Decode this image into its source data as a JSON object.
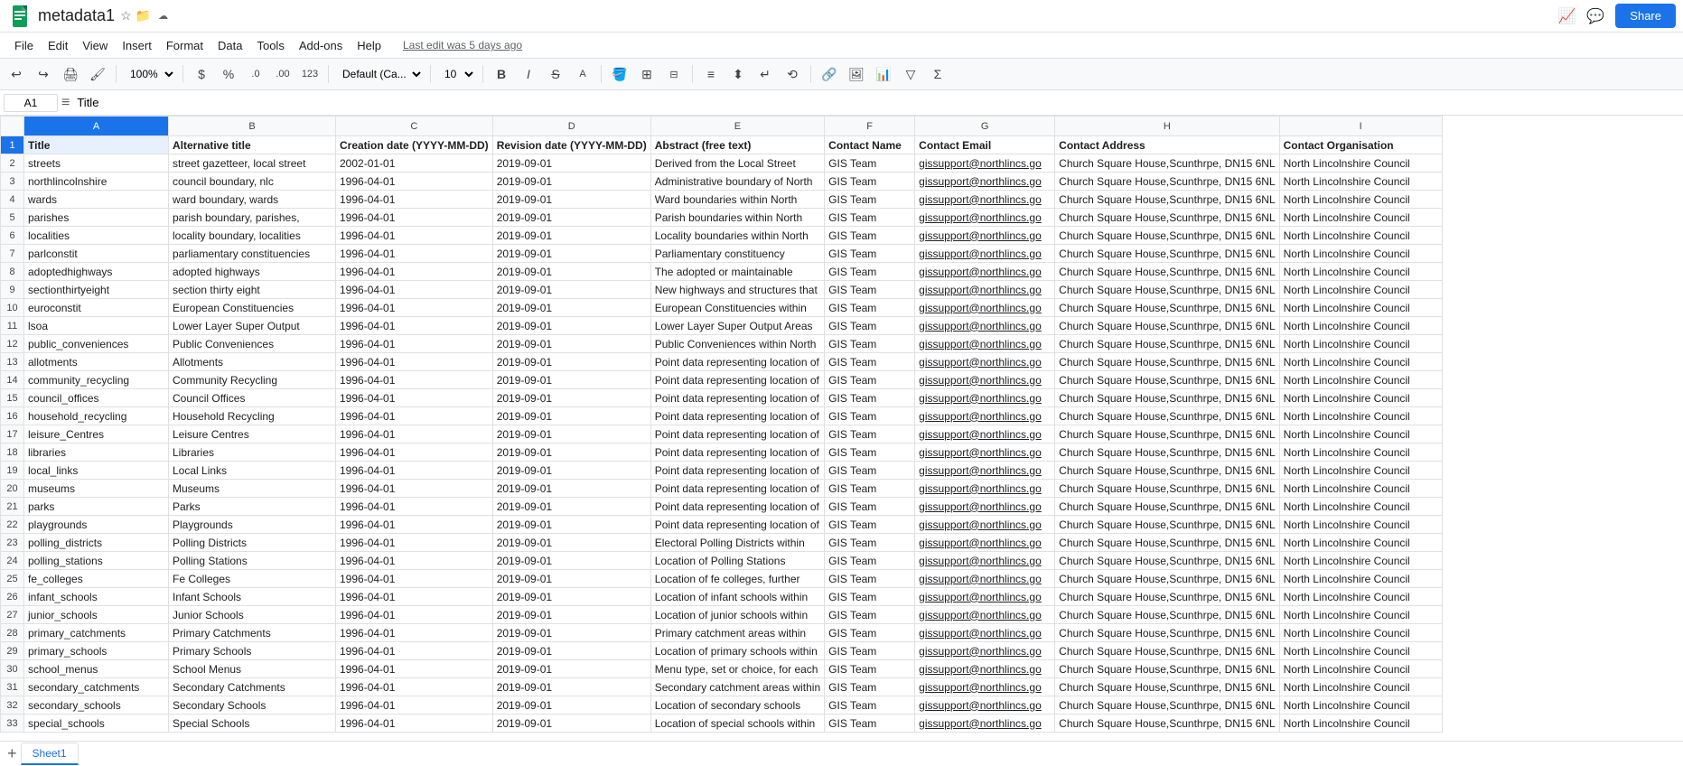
{
  "app": {
    "icon_color": "#0f9d58",
    "title": "metadata1",
    "last_edit": "Last edit was 5 days ago",
    "share_label": "Share"
  },
  "menu": {
    "items": [
      "File",
      "Edit",
      "View",
      "Insert",
      "Format",
      "Data",
      "Tools",
      "Add-ons",
      "Help"
    ]
  },
  "toolbar": {
    "zoom": "100%",
    "format_dollar": "$",
    "format_pct": "%",
    "format_comma": ".0",
    "format_dec": ".00",
    "format_123": "123",
    "font_family": "Default (Ca...",
    "font_size": "10"
  },
  "formula_bar": {
    "cell_name": "A1",
    "formula_value": "Title"
  },
  "columns": [
    {
      "id": "A",
      "label": "A"
    },
    {
      "id": "B",
      "label": "B"
    },
    {
      "id": "C",
      "label": "C"
    },
    {
      "id": "D",
      "label": "D"
    },
    {
      "id": "E",
      "label": "E"
    },
    {
      "id": "F",
      "label": "F"
    },
    {
      "id": "G",
      "label": "G"
    },
    {
      "id": "H",
      "label": "H"
    },
    {
      "id": "I",
      "label": "I"
    }
  ],
  "header_row": {
    "title": "Title",
    "alt_title": "Alternative title",
    "creation_date": "Creation date (YYYY-MM-DD)",
    "revision_date": "Revision date (YYYY-MM-DD)",
    "abstract": "Abstract (free text)",
    "contact_name": "Contact Name",
    "contact_email": "Contact Email",
    "contact_address": "Contact Address",
    "contact_org": "Contact Organisation"
  },
  "rows": [
    {
      "title": "streets",
      "alt": "street gazetteer, local street",
      "created": "2002-01-01",
      "revised": "2019-09-01",
      "abstract": "Derived from the Local Street",
      "contact_name": "GIS Team",
      "contact_email": "gissupport@northlincs.go",
      "contact_address": "Church Square House,Scunthrpe, DN15 6NL",
      "contact_org": "North Lincolnshire Council"
    },
    {
      "title": "northlincolnshire",
      "alt": "council boundary, nlc",
      "created": "1996-04-01",
      "revised": "2019-09-01",
      "abstract": "Administrative boundary of North",
      "contact_name": "GIS Team",
      "contact_email": "gissupport@northlincs.go",
      "contact_address": "Church Square House,Scunthrpe, DN15 6NL",
      "contact_org": "North Lincolnshire Council"
    },
    {
      "title": "wards",
      "alt": "ward boundary, wards",
      "created": "1996-04-01",
      "revised": "2019-09-01",
      "abstract": "Ward boundaries within North",
      "contact_name": "GIS Team",
      "contact_email": "gissupport@northlincs.go",
      "contact_address": "Church Square House,Scunthrpe, DN15 6NL",
      "contact_org": "North Lincolnshire Council"
    },
    {
      "title": "parishes",
      "alt": "parish boundary, parishes,",
      "created": "1996-04-01",
      "revised": "2019-09-01",
      "abstract": "Parish boundaries within North",
      "contact_name": "GIS Team",
      "contact_email": "gissupport@northlincs.go",
      "contact_address": "Church Square House,Scunthrpe, DN15 6NL",
      "contact_org": "North Lincolnshire Council"
    },
    {
      "title": "localities",
      "alt": "locality boundary, localities",
      "created": "1996-04-01",
      "revised": "2019-09-01",
      "abstract": "Locality boundaries within North",
      "contact_name": "GIS Team",
      "contact_email": "gissupport@northlincs.go",
      "contact_address": "Church Square House,Scunthrpe, DN15 6NL",
      "contact_org": "North Lincolnshire Council"
    },
    {
      "title": "parlconstit",
      "alt": "parliamentary constituencies",
      "created": "1996-04-01",
      "revised": "2019-09-01",
      "abstract": "Parliamentary constituency",
      "contact_name": "GIS Team",
      "contact_email": "gissupport@northlincs.go",
      "contact_address": "Church Square House,Scunthrpe, DN15 6NL",
      "contact_org": "North Lincolnshire Council"
    },
    {
      "title": "adoptedhighways",
      "alt": "adopted highways",
      "created": "1996-04-01",
      "revised": "2019-09-01",
      "abstract": "The adopted or maintainable",
      "contact_name": "GIS Team",
      "contact_email": "gissupport@northlincs.go",
      "contact_address": "Church Square House,Scunthrpe, DN15 6NL",
      "contact_org": "North Lincolnshire Council"
    },
    {
      "title": "sectionthirtyeight",
      "alt": "section thirty eight",
      "created": "1996-04-01",
      "revised": "2019-09-01",
      "abstract": "New highways and structures that",
      "contact_name": "GIS Team",
      "contact_email": "gissupport@northlincs.go",
      "contact_address": "Church Square House,Scunthrpe, DN15 6NL",
      "contact_org": "North Lincolnshire Council"
    },
    {
      "title": "euroconstit",
      "alt": "European Constituencies",
      "created": "1996-04-01",
      "revised": "2019-09-01",
      "abstract": "European Constituencies within",
      "contact_name": "GIS Team",
      "contact_email": "gissupport@northlincs.go",
      "contact_address": "Church Square House,Scunthrpe, DN15 6NL",
      "contact_org": "North Lincolnshire Council"
    },
    {
      "title": "lsoa",
      "alt": "Lower Layer Super Output",
      "created": "1996-04-01",
      "revised": "2019-09-01",
      "abstract": "Lower Layer Super Output Areas",
      "contact_name": "GIS Team",
      "contact_email": "gissupport@northlincs.go",
      "contact_address": "Church Square House,Scunthrpe, DN15 6NL",
      "contact_org": "North Lincolnshire Council"
    },
    {
      "title": "public_conveniences",
      "alt": "Public Conveniences",
      "created": "1996-04-01",
      "revised": "2019-09-01",
      "abstract": "Public Conveniences within North",
      "contact_name": "GIS Team",
      "contact_email": "gissupport@northlincs.go",
      "contact_address": "Church Square House,Scunthrpe, DN15 6NL",
      "contact_org": "North Lincolnshire Council"
    },
    {
      "title": "allotments",
      "alt": "Allotments",
      "created": "1996-04-01",
      "revised": "2019-09-01",
      "abstract": "Point data representing location of",
      "contact_name": "GIS Team",
      "contact_email": "gissupport@northlincs.go",
      "contact_address": "Church Square House,Scunthrpe, DN15 6NL",
      "contact_org": "North Lincolnshire Council"
    },
    {
      "title": "community_recycling",
      "alt": "Community Recycling",
      "created": "1996-04-01",
      "revised": "2019-09-01",
      "abstract": "Point data representing location of",
      "contact_name": "GIS Team",
      "contact_email": "gissupport@northlincs.go",
      "contact_address": "Church Square House,Scunthrpe, DN15 6NL",
      "contact_org": "North Lincolnshire Council"
    },
    {
      "title": "council_offices",
      "alt": "Council Offices",
      "created": "1996-04-01",
      "revised": "2019-09-01",
      "abstract": "Point data representing location of",
      "contact_name": "GIS Team",
      "contact_email": "gissupport@northlincs.go",
      "contact_address": "Church Square House,Scunthrpe, DN15 6NL",
      "contact_org": "North Lincolnshire Council"
    },
    {
      "title": "household_recycling",
      "alt": "Household Recycling",
      "created": "1996-04-01",
      "revised": "2019-09-01",
      "abstract": "Point data representing location of",
      "contact_name": "GIS Team",
      "contact_email": "gissupport@northlincs.go",
      "contact_address": "Church Square House,Scunthrpe, DN15 6NL",
      "contact_org": "North Lincolnshire Council"
    },
    {
      "title": "leisure_Centres",
      "alt": "Leisure Centres",
      "created": "1996-04-01",
      "revised": "2019-09-01",
      "abstract": "Point data representing location of",
      "contact_name": "GIS Team",
      "contact_email": "gissupport@northlincs.go",
      "contact_address": "Church Square House,Scunthrpe, DN15 6NL",
      "contact_org": "North Lincolnshire Council"
    },
    {
      "title": "libraries",
      "alt": "Libraries",
      "created": "1996-04-01",
      "revised": "2019-09-01",
      "abstract": "Point data representing location of",
      "contact_name": "GIS Team",
      "contact_email": "gissupport@northlincs.go",
      "contact_address": "Church Square House,Scunthrpe, DN15 6NL",
      "contact_org": "North Lincolnshire Council"
    },
    {
      "title": "local_links",
      "alt": "Local Links",
      "created": "1996-04-01",
      "revised": "2019-09-01",
      "abstract": "Point data representing location of",
      "contact_name": "GIS Team",
      "contact_email": "gissupport@northlincs.go",
      "contact_address": "Church Square House,Scunthrpe, DN15 6NL",
      "contact_org": "North Lincolnshire Council"
    },
    {
      "title": "museums",
      "alt": "Museums",
      "created": "1996-04-01",
      "revised": "2019-09-01",
      "abstract": "Point data representing location of",
      "contact_name": "GIS Team",
      "contact_email": "gissupport@northlincs.go",
      "contact_address": "Church Square House,Scunthrpe, DN15 6NL",
      "contact_org": "North Lincolnshire Council"
    },
    {
      "title": "parks",
      "alt": "Parks",
      "created": "1996-04-01",
      "revised": "2019-09-01",
      "abstract": "Point data representing location of",
      "contact_name": "GIS Team",
      "contact_email": "gissupport@northlincs.go",
      "contact_address": "Church Square House,Scunthrpe, DN15 6NL",
      "contact_org": "North Lincolnshire Council"
    },
    {
      "title": "playgrounds",
      "alt": "Playgrounds",
      "created": "1996-04-01",
      "revised": "2019-09-01",
      "abstract": "Point data representing location of",
      "contact_name": "GIS Team",
      "contact_email": "gissupport@northlincs.go",
      "contact_address": "Church Square House,Scunthrpe, DN15 6NL",
      "contact_org": "North Lincolnshire Council"
    },
    {
      "title": "polling_districts",
      "alt": "Polling Districts",
      "created": "1996-04-01",
      "revised": "2019-09-01",
      "abstract": "Electoral Polling Districts within",
      "contact_name": "GIS Team",
      "contact_email": "gissupport@northlincs.go",
      "contact_address": "Church Square House,Scunthrpe, DN15 6NL",
      "contact_org": "North Lincolnshire Council"
    },
    {
      "title": "polling_stations",
      "alt": "Polling Stations",
      "created": "1996-04-01",
      "revised": "2019-09-01",
      "abstract": "Location of Polling Stations",
      "contact_name": "GIS Team",
      "contact_email": "gissupport@northlincs.go",
      "contact_address": "Church Square House,Scunthrpe, DN15 6NL",
      "contact_org": "North Lincolnshire Council"
    },
    {
      "title": "fe_colleges",
      "alt": "Fe Colleges",
      "created": "1996-04-01",
      "revised": "2019-09-01",
      "abstract": "Location of fe colleges, further",
      "contact_name": "GIS Team",
      "contact_email": "gissupport@northlincs.go",
      "contact_address": "Church Square House,Scunthrpe, DN15 6NL",
      "contact_org": "North Lincolnshire Council"
    },
    {
      "title": "infant_schools",
      "alt": "Infant Schools",
      "created": "1996-04-01",
      "revised": "2019-09-01",
      "abstract": "Location of infant schools within",
      "contact_name": "GIS Team",
      "contact_email": "gissupport@northlincs.go",
      "contact_address": "Church Square House,Scunthrpe, DN15 6NL",
      "contact_org": "North Lincolnshire Council"
    },
    {
      "title": "junior_schools",
      "alt": "Junior Schools",
      "created": "1996-04-01",
      "revised": "2019-09-01",
      "abstract": "Location of junior schools within",
      "contact_name": "GIS Team",
      "contact_email": "gissupport@northlincs.go",
      "contact_address": "Church Square House,Scunthrpe, DN15 6NL",
      "contact_org": "North Lincolnshire Council"
    },
    {
      "title": "primary_catchments",
      "alt": "Primary Catchments",
      "created": "1996-04-01",
      "revised": "2019-09-01",
      "abstract": "Primary catchment areas within",
      "contact_name": "GIS Team",
      "contact_email": "gissupport@northlincs.go",
      "contact_address": "Church Square House,Scunthrpe, DN15 6NL",
      "contact_org": "North Lincolnshire Council"
    },
    {
      "title": "primary_schools",
      "alt": "Primary Schools",
      "created": "1996-04-01",
      "revised": "2019-09-01",
      "abstract": "Location of primary schools within",
      "contact_name": "GIS Team",
      "contact_email": "gissupport@northlincs.go",
      "contact_address": "Church Square House,Scunthrpe, DN15 6NL",
      "contact_org": "North Lincolnshire Council"
    },
    {
      "title": "school_menus",
      "alt": "School Menus",
      "created": "1996-04-01",
      "revised": "2019-09-01",
      "abstract": "Menu type, set or choice, for each",
      "contact_name": "GIS Team",
      "contact_email": "gissupport@northlincs.go",
      "contact_address": "Church Square House,Scunthrpe, DN15 6NL",
      "contact_org": "North Lincolnshire Council"
    },
    {
      "title": "secondary_catchments",
      "alt": "Secondary Catchments",
      "created": "1996-04-01",
      "revised": "2019-09-01",
      "abstract": "Secondary catchment areas within",
      "contact_name": "GIS Team",
      "contact_email": "gissupport@northlincs.go",
      "contact_address": "Church Square House,Scunthrpe, DN15 6NL",
      "contact_org": "North Lincolnshire Council"
    },
    {
      "title": "secondary_schools",
      "alt": "Secondary Schools",
      "created": "1996-04-01",
      "revised": "2019-09-01",
      "abstract": "Location of secondary schools",
      "contact_name": "GIS Team",
      "contact_email": "gissupport@northlincs.go",
      "contact_address": "Church Square House,Scunthrpe, DN15 6NL",
      "contact_org": "North Lincolnshire Council"
    },
    {
      "title": "special_schools",
      "alt": "Special Schools",
      "created": "1996-04-01",
      "revised": "2019-09-01",
      "abstract": "Location of special schools within",
      "contact_name": "GIS Team",
      "contact_email": "gissupport@northlincs.go",
      "contact_address": "Church Square House,Scunthrpe, DN15 6NL",
      "contact_org": "North Lincolnshire Council"
    }
  ],
  "sheet_tab": "Sheet1"
}
